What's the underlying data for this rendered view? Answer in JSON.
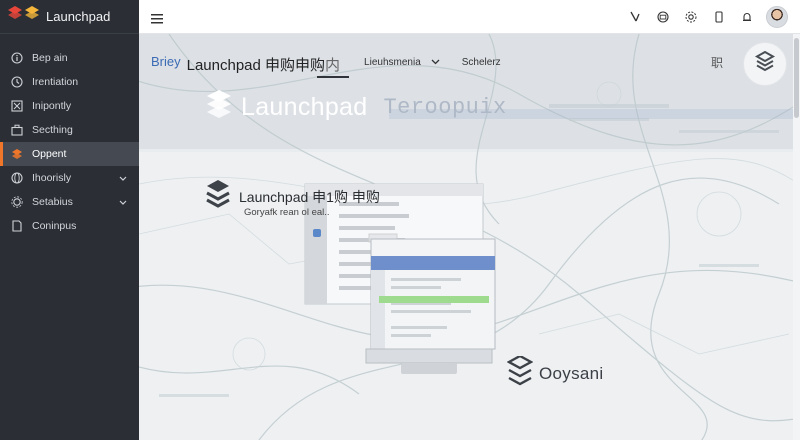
{
  "app": {
    "name": "Launchpad"
  },
  "sidebar": {
    "items": [
      {
        "label": "Bep ain",
        "icon": "info-icon"
      },
      {
        "label": "Irentiation",
        "icon": "clock-icon"
      },
      {
        "label": "Inipontly",
        "icon": "box-icon"
      },
      {
        "label": "Secthing",
        "icon": "briefcase-icon"
      },
      {
        "label": "Oppent",
        "icon": "launchpad-icon",
        "active": true
      },
      {
        "label": "Ihoorisly",
        "icon": "globe-icon",
        "expandable": true
      },
      {
        "label": "Setabius",
        "icon": "gear-icon",
        "expandable": true
      },
      {
        "label": "Coninpus",
        "icon": "document-icon"
      }
    ]
  },
  "topbar": {
    "icons": [
      "pen-icon",
      "mail-icon",
      "settings-icon",
      "phone-icon",
      "bell-icon",
      "avatar"
    ]
  },
  "main": {
    "tabs": {
      "brief": "Briey",
      "title": "Launchpad 申购申购",
      "title_tail": "内",
      "menu": "Lieuhsmenia",
      "schedule": "Schelerz"
    },
    "grid_label": "职",
    "hero": {
      "word": "Launchpad",
      "word2": "Teroopuix"
    },
    "card": {
      "title": "Launchpad 申1购 申购",
      "subtitle": "Goryafk rean ol eal.."
    },
    "footer_brand": "Ooysani"
  },
  "colors": {
    "accent": "#f0772a",
    "sidebar_bg": "#2b2f35",
    "brief_blue": "#3c6bb4"
  }
}
